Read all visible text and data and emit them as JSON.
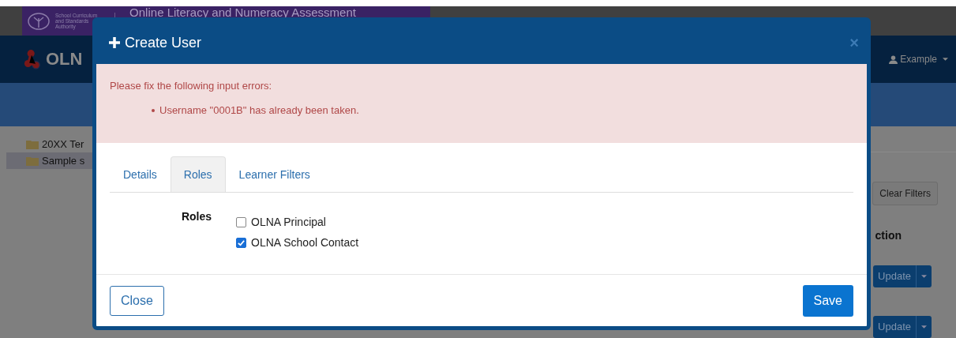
{
  "page": {
    "authority": [
      "School Curriculum",
      "and Standards",
      "Authority"
    ],
    "banner_title": "Online Literacy and Numeracy Assessment",
    "app_name": "OLN",
    "user_menu": "Example",
    "sidebar": {
      "items": [
        {
          "label": "20XX Ter",
          "selected": false
        },
        {
          "label": "Sample s",
          "selected": true
        }
      ]
    },
    "clear_filters": "Clear Filters",
    "column_header": "ction",
    "row_buttons": [
      "Update",
      "Update"
    ]
  },
  "dialog": {
    "title": "Create User",
    "close_symbol": "×",
    "alert": {
      "heading": "Please fix the following input errors:",
      "errors": [
        "Username \"0001B\" has already been taken."
      ]
    },
    "tabs": [
      {
        "label": "Details",
        "selected": false
      },
      {
        "label": "Roles",
        "selected": true
      },
      {
        "label": "Learner Filters",
        "selected": false
      }
    ],
    "roles": {
      "label": "Roles",
      "options": [
        {
          "label": "OLNA Principal",
          "checked": false
        },
        {
          "label": "OLNA School Contact",
          "checked": true
        }
      ]
    },
    "buttons": {
      "close": "Close",
      "save": "Save"
    }
  }
}
